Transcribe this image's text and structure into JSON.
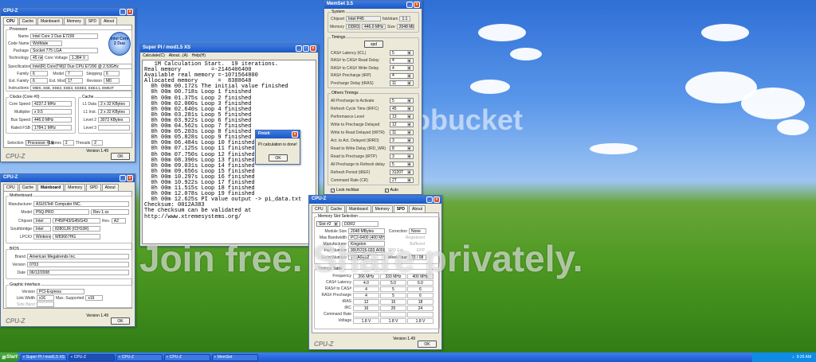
{
  "cpuz1": {
    "title": "CPU-Z",
    "tabs": [
      "CPU",
      "Cache",
      "Mainboard",
      "Memory",
      "SPD",
      "About"
    ],
    "processor": {
      "label": "Processor",
      "rows": [
        {
          "k": "Name",
          "v": "Intel Core 2 Duo E7200"
        },
        {
          "k": "Code Name",
          "v": "Wolfdale"
        },
        {
          "k": "Package",
          "v": "Socket 775 LGA"
        },
        {
          "k": "Technology",
          "v": "45 nm"
        },
        {
          "k": "Core Voltage",
          "v": "1.384 V"
        }
      ],
      "spec": "Intel(R) Core(TM)2 Duo CPU  E7200 @ 2.53GHz",
      "family": "6",
      "model": "7",
      "stepping": "6",
      "ext_family": "6",
      "ext_model": "17",
      "revision": "M0",
      "instructions": "MMX, SSE, SSE2, SSE3, SSSE3, SSE4.1, EM64T",
      "logo": "intel Core 2 Duo"
    },
    "clocks": {
      "label": "Clocks (Core #0)",
      "core_speed": "4237.2 MHz",
      "multiplier": "x 9.5",
      "bus_speed": "446.0 MHz",
      "rated_fsb": "1784.1 MHz"
    },
    "cache": {
      "label": "Cache",
      "l1d": "2 x 32 KBytes",
      "l1i": "2 x 32 KBytes",
      "l2": "3072 KBytes",
      "l3": ""
    },
    "selection": "Processor #1",
    "cores": "2",
    "threads": "2",
    "version": "Version 1.49",
    "ok": "OK",
    "brand": "CPU-Z"
  },
  "cpuz2": {
    "title": "CPU-Z",
    "tabs": [
      "CPU",
      "Cache",
      "Mainboard",
      "Memory",
      "SPD",
      "About"
    ],
    "motherboard": {
      "label": "Motherboard",
      "manufacturer": "ASUSTeK Computer INC.",
      "model": "P5Q-PRO",
      "rev": "Rev 1.xx",
      "chipset_vendor": "Intel",
      "chipset": "P45/P43/G45/G43",
      "chipset_rev": "A2",
      "south_vendor": "Intel",
      "south": "82801JR (ICH10R)",
      "lpcio_vendor": "Winbond",
      "lpcio": "W83667HG"
    },
    "bios": {
      "label": "BIOS",
      "brand": "American Megatrends Inc.",
      "version": "0703",
      "date": "06/12/2008"
    },
    "graphic": {
      "label": "Graphic Interface",
      "version": "PCI-Express",
      "link_width": "x16",
      "max_supported": "x16",
      "side_band": ""
    },
    "version": "Version 1.49",
    "ok": "OK",
    "brand": "CPU-Z"
  },
  "superpi": {
    "title": "Super PI / mod1.5 XS",
    "menu": [
      "Calculate(C)",
      "About...(A)",
      "Help(H)"
    ],
    "lines": [
      "   1M Calculation Start.  19 iterations.",
      "Real memory         =-2146406400",
      "Available real memory =-1071564800",
      "Allocated memory      =  8388648",
      "  0h 00m 00.172s The initial value finished",
      "  0h 00m 00.718s Loop 1 finished",
      "  0h 00m 01.375s Loop 2 finished",
      "  0h 00m 02.000s Loop 3 finished",
      "  0h 00m 02.640s Loop 4 finished",
      "  0h 00m 03.281s Loop 5 finished",
      "  0h 00m 03.922s Loop 6 finished",
      "  0h 00m 04.562s Loop 7 finished",
      "  0h 00m 05.203s Loop 8 finished",
      "  0h 00m 05.828s Loop 9 finished",
      "  0h 00m 06.484s Loop 10 finished",
      "  0h 00m 07.125s Loop 11 finished",
      "  0h 00m 07.750s Loop 12 finished",
      "  0h 00m 08.390s Loop 13 finished",
      "  0h 00m 09.031s Loop 14 finished",
      "  0h 00m 09.656s Loop 15 finished",
      "  0h 00m 10.297s Loop 16 finished",
      "  0h 00m 10.922s Loop 17 finished",
      "  0h 00m 11.515s Loop 18 finished",
      "  0h 00m 12.078s Loop 19 finished",
      "  0h 00m 12.625s PI value output -> pi_data.txt",
      "",
      "Checksum: 0012A383",
      "The checksum can be validated at",
      "http://www.xtremesystems.org/"
    ]
  },
  "finish": {
    "title": "Finish",
    "message": "PI calculation is done!",
    "ok": "OK"
  },
  "memset": {
    "title": "MemSet 3.5",
    "system": {
      "label": "System",
      "chipset_label": "Chipset",
      "chipset": "Intel P45",
      "fsb_dram_label": "fsb/dram",
      "fsb_dram": "1:1",
      "memory_label": "Memory",
      "type": "DDR3",
      "freq": "446.0 MHz",
      "size_label": "Size",
      "size": "2048 Mb"
    },
    "timings": {
      "label": "Timings",
      "spd": "spd",
      "rows": [
        {
          "k": "CAS# Latency (tCL)",
          "v": "5"
        },
        {
          "k": "RAS# to CAS# Read Delay",
          "v": "4"
        },
        {
          "k": "RAS# to CAS# Write Delay",
          "v": "4"
        },
        {
          "k": "RAS# Precharge (tRP)",
          "v": "4"
        },
        {
          "k": "Precharge Delay (tRAS)",
          "v": "11"
        }
      ]
    },
    "other": {
      "label": "Others Timings",
      "rows": [
        {
          "k": "All Precharge to Activate",
          "v": "5"
        },
        {
          "k": "Refresh Cycle Time (tRFC)",
          "v": "45"
        },
        {
          "k": "Performance Level",
          "v": "13"
        },
        {
          "k": "Write to Precharge Delayed",
          "v": "12"
        },
        {
          "k": "Write to Read Delayed (tWTR)",
          "v": "11"
        },
        {
          "k": "Act. to Act. Delayed (tRRD)",
          "v": "3"
        },
        {
          "k": "Read to Write Delay (tRD_WR)",
          "v": "8"
        },
        {
          "k": "Read to Precharge (tRTP)",
          "v": "3"
        },
        {
          "k": "All Precharge to Refresh delay",
          "v": "5"
        },
        {
          "k": "Refresh Period (tREF)",
          "v": "3120T"
        },
        {
          "k": "Command Rate (CR)",
          "v": "2T"
        }
      ]
    },
    "lock": "Lock mchbar",
    "auto": "Auto"
  },
  "cpuz3": {
    "title": "CPU-Z",
    "tabs": [
      "CPU",
      "Cache",
      "Mainboard",
      "Memory",
      "SPD",
      "About"
    ],
    "slot": {
      "label": "Memory Slot Selection",
      "slot": "Slot #2",
      "type": "DDR2",
      "module_size": "2048 MBytes",
      "max_bw": "PC2-6400 (400 MHz)",
      "manufacturer": "Kingston",
      "part_number": "99U5315-033.A00LF",
      "serial": "171A0E52",
      "week_year": "23 / 08",
      "correction": "None",
      "registered": "Registered",
      "buffered": "Buffered",
      "epp": "EPP",
      "spd_ext": "SPD Ext.",
      "labels": [
        "Module Size",
        "Max Bandwidth",
        "Manufacturer",
        "Part Number",
        "Serial Number"
      ],
      "week_label": "Week/Year",
      "correction_label": "Correction"
    },
    "timings": {
      "label": "Timings Table",
      "cols": [
        "266 MHz",
        "333 MHz",
        "400 MHz"
      ],
      "rows": [
        {
          "k": "Frequency",
          "v": [
            "266 MHz",
            "333 MHz",
            "400 MHz"
          ]
        },
        {
          "k": "CAS# Latency",
          "v": [
            "4.0",
            "5.0",
            "6.0"
          ]
        },
        {
          "k": "RAS# to CAS#",
          "v": [
            "4",
            "5",
            "6"
          ]
        },
        {
          "k": "RAS# Precharge",
          "v": [
            "4",
            "5",
            "6"
          ]
        },
        {
          "k": "tRAS",
          "v": [
            "12",
            "15",
            "18"
          ]
        },
        {
          "k": "tRC",
          "v": [
            "16",
            "20",
            "24"
          ]
        },
        {
          "k": "Command Rate",
          "v": [
            "",
            "",
            ""
          ]
        },
        {
          "k": "Voltage",
          "v": [
            "1.8 V",
            "1.8 V",
            "1.8 V"
          ]
        }
      ]
    },
    "version": "Version 1.49",
    "ok": "OK",
    "brand": "CPU-Z"
  },
  "taskbar": {
    "start": "Start",
    "items": [
      "Super PI / mod1.5 XS",
      "CPU-Z",
      "CPU-Z",
      "CPU-Z",
      "MemSet"
    ],
    "clock": "9:26 AM"
  },
  "watermark": {
    "logo": "photobucket",
    "tag": "Join free. Share privately."
  }
}
